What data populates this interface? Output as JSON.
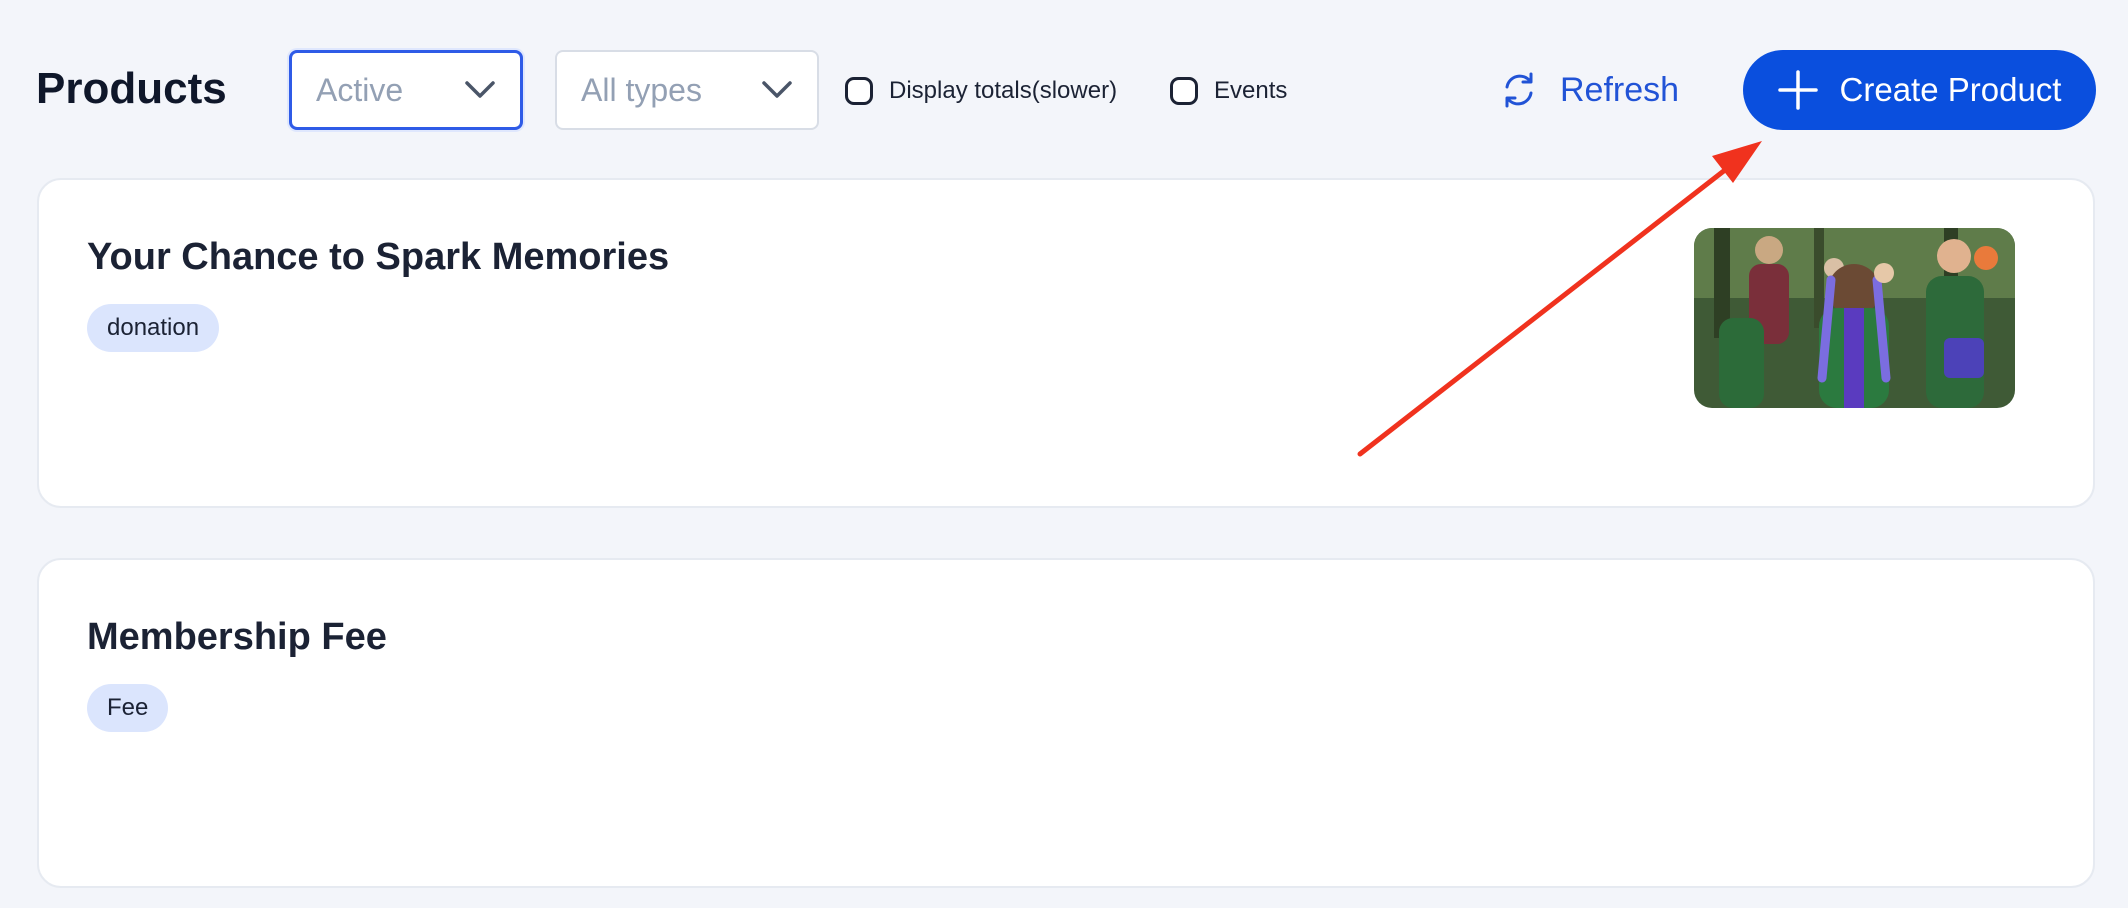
{
  "header": {
    "title": "Products",
    "status_filter": {
      "value": "Active"
    },
    "type_filter": {
      "value": "All types"
    },
    "checkboxes": {
      "display_totals": "Display totals(slower)",
      "events": "Events"
    },
    "refresh_label": "Refresh",
    "create_label": "Create Product"
  },
  "colors": {
    "accent": "#0a4fde",
    "link": "#2153d6",
    "annotation_arrow": "#f0321e"
  },
  "products": [
    {
      "title": "Your Chance to Spark Memories",
      "tag": "donation",
      "has_image": true
    },
    {
      "title": "Membership Fee",
      "tag": "Fee",
      "has_image": false
    }
  ]
}
